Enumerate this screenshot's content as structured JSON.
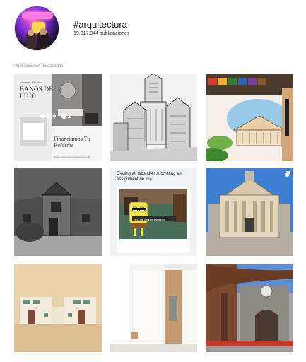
{
  "hashtag": {
    "name": "#arquitectura",
    "posts_count": "19,017,944 publicaciones"
  },
  "section": {
    "title": "Publicaciones destacadas"
  },
  "posts": [
    {
      "id": "post-1",
      "title_small": "Informes Estudios",
      "title": "BAÑOS DE LUJO",
      "subtitle": "Financiamos Tu Reforma",
      "footer": "Reglas Plazo Financiamiento Asesoria",
      "likes": "110",
      "comments": "2",
      "icon": "heart-icon"
    },
    {
      "id": "post-2"
    },
    {
      "id": "post-3"
    },
    {
      "id": "post-4"
    },
    {
      "id": "post-5",
      "caption": "Closing all tabs after submitting an assignment be like",
      "sign": "FOLLOW @DESIGNSOFFICE"
    },
    {
      "id": "post-6",
      "icon": "multiple-images-icon"
    },
    {
      "id": "post-7"
    },
    {
      "id": "post-8"
    },
    {
      "id": "post-9"
    }
  ]
}
